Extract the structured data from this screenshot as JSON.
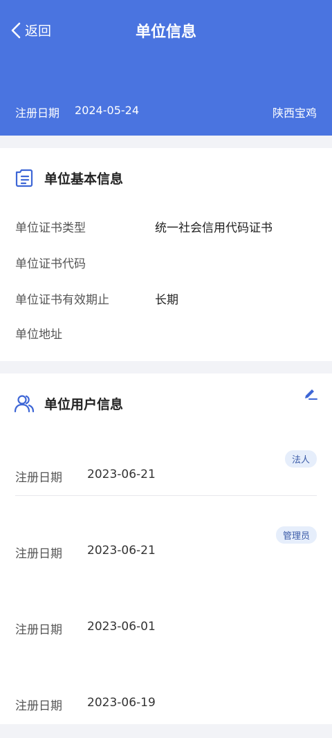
{
  "header": {
    "back_label": "返回",
    "title": "单位信息",
    "reg_label": "注册日期",
    "reg_date": "2024-05-24",
    "region": "陕西宝鸡"
  },
  "basic_info": {
    "section_title": "单位基本信息",
    "rows": [
      {
        "label": "单位证书类型",
        "value": "统一社会信用代码证书"
      },
      {
        "label": "单位证书代码",
        "value": ""
      },
      {
        "label": "单位证书有效期止",
        "value": "长期"
      },
      {
        "label": "单位地址",
        "value": ""
      }
    ]
  },
  "user_info": {
    "section_title": "单位用户信息",
    "users": [
      {
        "badge": "法人",
        "label": "注册日期",
        "date": "2023-06-21"
      },
      {
        "badge": "管理员",
        "label": "注册日期",
        "date": "2023-06-21"
      },
      {
        "badge": "",
        "label": "注册日期",
        "date": "2023-06-01"
      },
      {
        "badge": "",
        "label": "注册日期",
        "date": "2023-06-19"
      }
    ]
  },
  "colors": {
    "header_bg": "#4a74e0",
    "badge_bg": "#e6eefb",
    "badge_text": "#3b5ba8"
  }
}
